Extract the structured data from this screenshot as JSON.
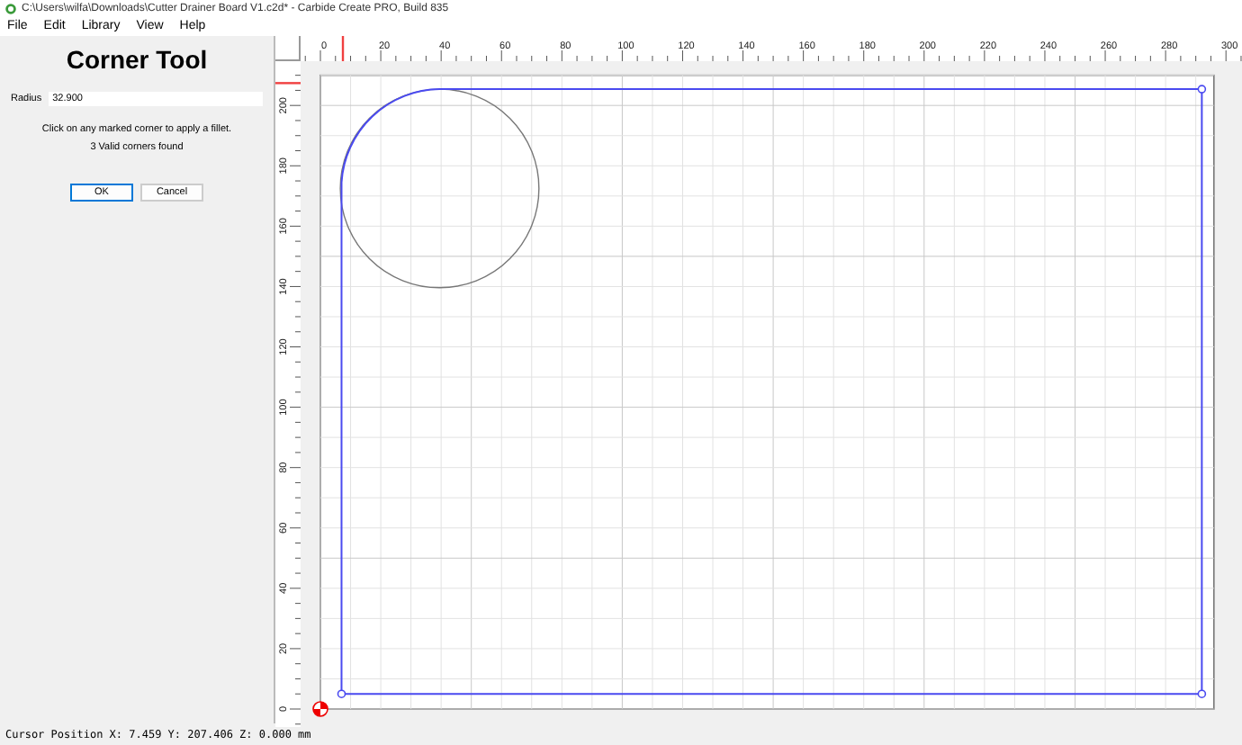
{
  "window": {
    "title": "C:\\Users\\wilfa\\Downloads\\Cutter Drainer Board  V1.c2d* - Carbide Create PRO, Build 835"
  },
  "menu": [
    {
      "label": "File"
    },
    {
      "label": "Edit"
    },
    {
      "label": "Library"
    },
    {
      "label": "View"
    },
    {
      "label": "Help"
    }
  ],
  "panel": {
    "title": "Corner Tool",
    "radius_label": "Radius",
    "radius_value": "32.900",
    "messages": [
      "Click on any marked corner to apply a fillet.",
      "3 Valid corners found"
    ],
    "buttons": [
      {
        "label": "OK",
        "selected": true
      },
      {
        "label": "Cancel",
        "selected": false
      }
    ]
  },
  "rulers": {
    "x_labels": [
      "0",
      "20",
      "40",
      "60",
      "80",
      "100",
      "120",
      "140",
      "160",
      "180",
      "200",
      "220",
      "240",
      "260",
      "280",
      "300"
    ],
    "y_labels": [
      "0",
      "20",
      "40",
      "60",
      "80",
      "100",
      "120",
      "140",
      "160",
      "180",
      "200"
    ]
  },
  "status_bar": "Cursor Position X: 7.459 Y: 207.406 Z: 0.000 mm"
}
